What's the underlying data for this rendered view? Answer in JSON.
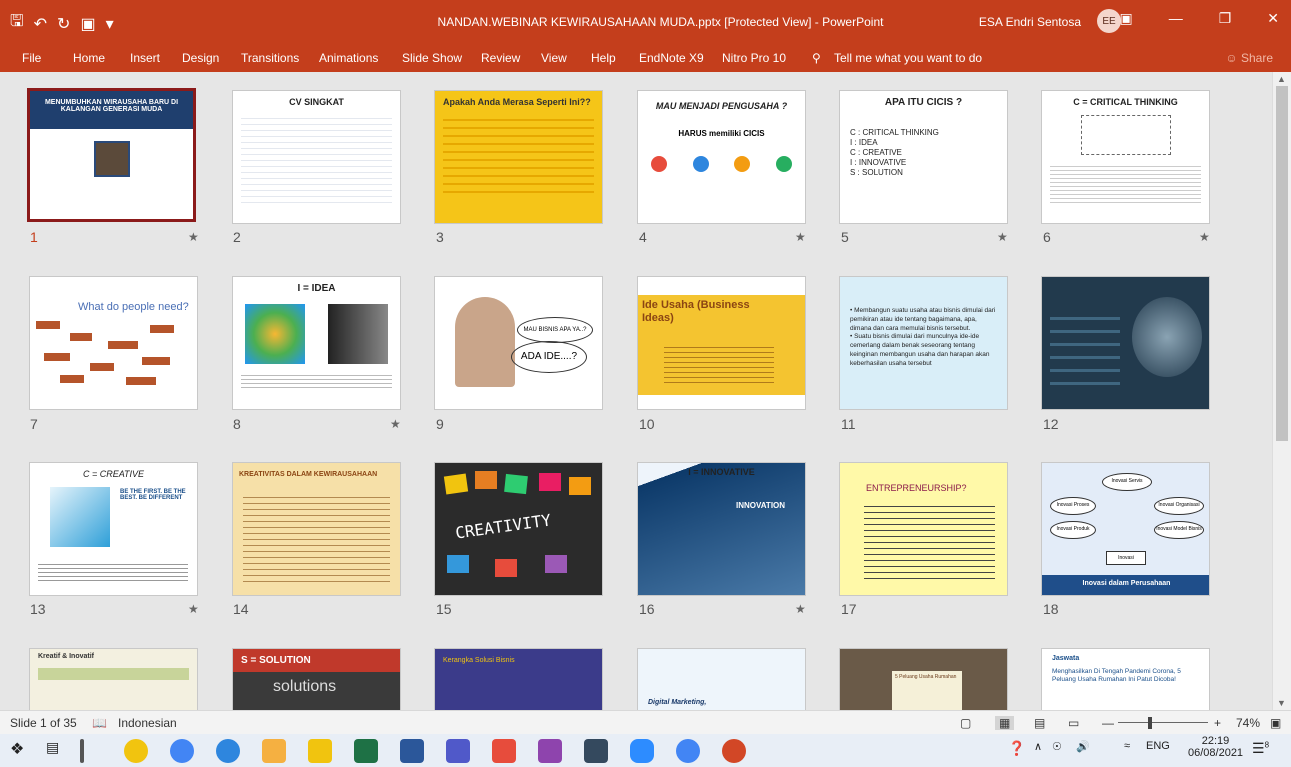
{
  "titlebar": {
    "title": "NANDAN.WEBINAR KEWIRAUSAHAAN MUDA.pptx [Protected View]  -  PowerPoint",
    "user": "ESA Endri Sentosa",
    "avatar": "EE",
    "save_icon": "save-icon",
    "undo_icon": "undo-icon",
    "redo_icon": "redo-icon",
    "customize_icon": "customize-icon"
  },
  "ribbon": {
    "tabs": [
      "File",
      "Home",
      "Insert",
      "Design",
      "Transitions",
      "Animations",
      "Slide Show",
      "Review",
      "View",
      "Help",
      "EndNote X9",
      "Nitro Pro 10"
    ],
    "tell_me": "Tell me what you want to do",
    "share": "Share"
  },
  "slides": [
    {
      "n": "1",
      "title": "MENUMBUHKAN WIRAUSAHA BARU DI KALANGAN GENERASI MUDA",
      "star": true
    },
    {
      "n": "2",
      "title": "CV SINGKAT",
      "star": false
    },
    {
      "n": "3",
      "title": "Apakah Anda Merasa Seperti Ini??",
      "star": false
    },
    {
      "n": "4",
      "title": "MAU MENJADI PENGUSAHA ?",
      "sub": "HARUS memiliki CICIS",
      "star": true
    },
    {
      "n": "5",
      "title": "APA ITU CICIS ?",
      "lines": [
        "C : CRITICAL THINKING",
        "I  : IDEA",
        "C : CREATIVE",
        "I : INNOVATIVE",
        "S : SOLUTION"
      ],
      "star": true
    },
    {
      "n": "6",
      "title": "C = CRITICAL THINKING",
      "star": true
    },
    {
      "n": "7",
      "title": "What do people need?",
      "star": false
    },
    {
      "n": "8",
      "title": "I = IDEA",
      "star": true
    },
    {
      "n": "9",
      "title": "MAU BISNIS APA YA..?",
      "sub": "ADA IDE....?",
      "star": false
    },
    {
      "n": "10",
      "title": "Ide Usaha (Business Ideas)",
      "star": false
    },
    {
      "n": "11",
      "title": "",
      "lines": [
        "• Membangun suatu usaha atau bisnis dimulai dari pemikiran atau ide tentang bagaimana, apa, dimana dan cara memulai bisnis tersebut.",
        "• Suatu bisnis dimulai dari munculnya ide-ide cemerlang dalam benak seseorang tentang keinginan membangun usaha dan harapan akan keberhasilan usaha tersebut"
      ],
      "star": false
    },
    {
      "n": "12",
      "title": "",
      "star": false
    },
    {
      "n": "13",
      "title": "C = CREATIVE",
      "sub": "BE THE FIRST. BE THE BEST. BE DIFFERENT",
      "star": true
    },
    {
      "n": "14",
      "title": "KREATIVITAS DALAM KEWIRAUSAHAAN",
      "star": false
    },
    {
      "n": "15",
      "title": "CREATIVITY",
      "star": false
    },
    {
      "n": "16",
      "title": "I = INNOVATIVE",
      "sub": "INNOVATION",
      "star": true
    },
    {
      "n": "17",
      "title": "ENTREPRENEURSHIP?",
      "star": false
    },
    {
      "n": "18",
      "title": "Inovasi dalam Perusahaan",
      "nodes": [
        "Inovasi Servis",
        "Inovasi Proses",
        "Inovasi Organisasi",
        "Inovasi Produk",
        "Inovasi Model Bisnis",
        "Inovasi"
      ],
      "star": false
    },
    {
      "n": "19",
      "title": "Kreatif & Inovatif",
      "star": false
    },
    {
      "n": "20",
      "title": "S = SOLUTION",
      "sub": "solutions",
      "star": false
    },
    {
      "n": "21",
      "title": "Kerangka Solusi Bisnis",
      "star": false
    },
    {
      "n": "22",
      "title": "Digital Marketing,",
      "star": false
    },
    {
      "n": "23",
      "title": "5 Peluang Usaha Rumahan",
      "star": false
    },
    {
      "n": "24",
      "title": "Menghasilkan Di Tengah Pandemi Corona, 5 Peluang Usaha Rumahan Ini Patut Dicoba!",
      "sub": "Jaswata",
      "star": false
    }
  ],
  "status": {
    "slide_info": "Slide 1 of 35",
    "language": "Indonesian",
    "zoom": "74%"
  },
  "taskbar": {
    "time": "22:19",
    "date": "06/08/2021",
    "lang": "ENG",
    "notif": "8"
  }
}
